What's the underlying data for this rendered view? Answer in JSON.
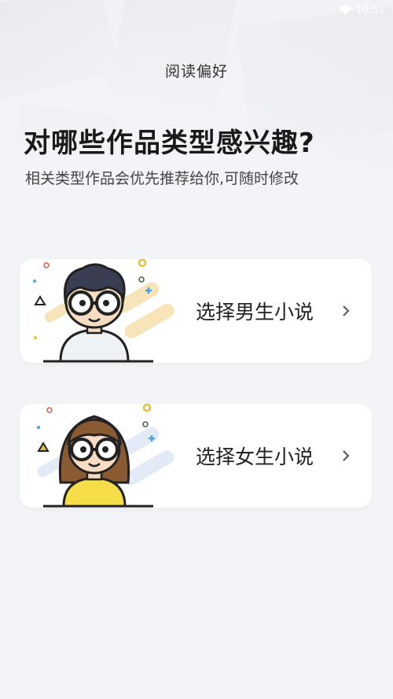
{
  "status": {
    "time": "10:51",
    "icons": [
      "wifi-icon"
    ]
  },
  "page": {
    "title": "阅读偏好",
    "headline": "对哪些作品类型感兴趣?",
    "subline": "相关类型作品会优先推荐给你,可随时修改"
  },
  "options": [
    {
      "label": "选择男生小说",
      "icon": "male-avatar-illustration"
    },
    {
      "label": "选择女生小说",
      "icon": "female-avatar-illustration"
    }
  ],
  "colors": {
    "background": "#f3f4f8",
    "card": "#ffffff",
    "accent_yellow": "#f5d36a",
    "accent_blue": "#4aa3e6",
    "accent_red": "#e05a4a"
  }
}
